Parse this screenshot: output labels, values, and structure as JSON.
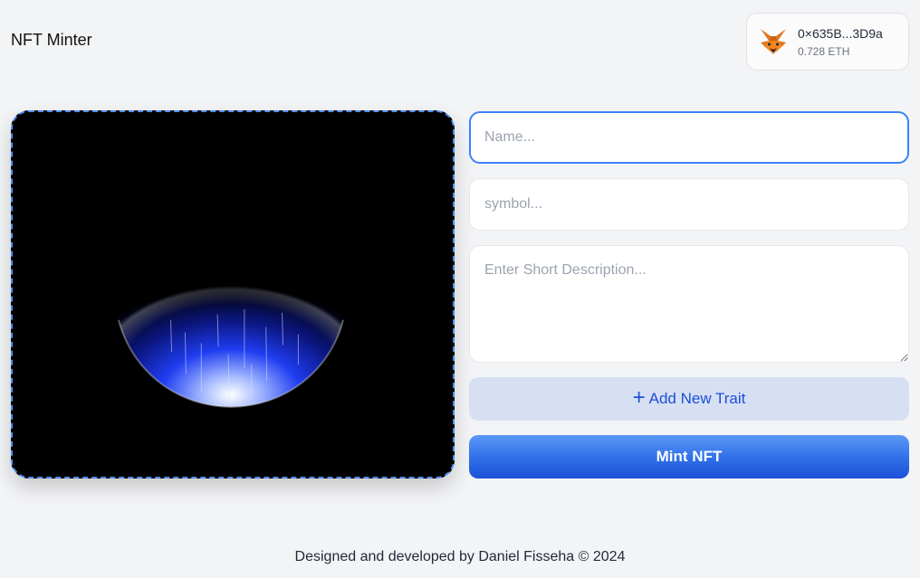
{
  "header": {
    "title": "NFT Minter"
  },
  "wallet": {
    "address": "0×635B...3D9a",
    "balance": "0.728 ETH",
    "icon": "metamask-fox-icon"
  },
  "form": {
    "name_placeholder": "Name...",
    "symbol_placeholder": "symbol...",
    "description_placeholder": "Enter Short Description...",
    "add_trait_label": "Add New Trait",
    "add_trait_icon": "+",
    "mint_label": "Mint NFT"
  },
  "footer": {
    "text": "Designed and developed by Daniel Fisseha © 2024"
  },
  "colors": {
    "accent": "#3b82f6",
    "mint_button": "#2e6fe8",
    "trait_button_bg": "#d6e0f2",
    "background": "#f3f4f6"
  }
}
